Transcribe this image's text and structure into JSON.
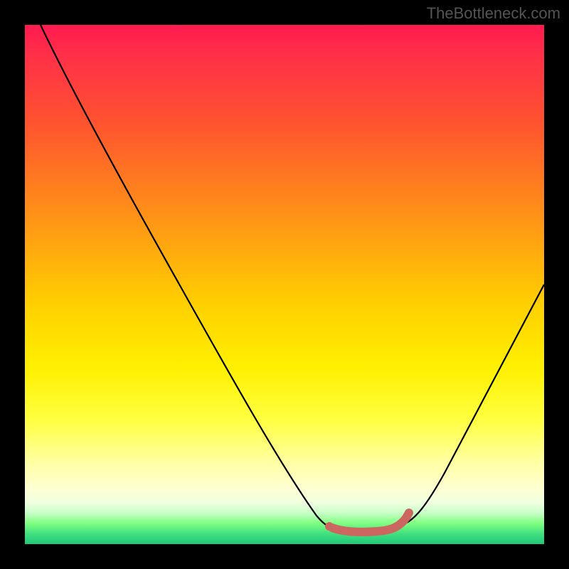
{
  "watermark": "TheBottleneck.com",
  "chart_data": {
    "type": "line",
    "title": "",
    "xlabel": "",
    "ylabel": "",
    "xlim": [
      0,
      100
    ],
    "ylim": [
      0,
      100
    ],
    "series": [
      {
        "name": "bottleneck-curve",
        "x": [
          3,
          10,
          20,
          30,
          40,
          50,
          55,
          58,
          60,
          63,
          67,
          70,
          73,
          78,
          85,
          92,
          100
        ],
        "y": [
          100,
          86,
          68,
          52,
          37,
          22,
          12,
          6,
          3,
          2,
          2,
          2,
          3,
          8,
          20,
          34,
          50
        ]
      },
      {
        "name": "optimal-range-marker",
        "x": [
          59,
          62,
          66,
          70,
          72,
          73
        ],
        "y": [
          3.2,
          2.3,
          2.2,
          2.5,
          3.3,
          4.8
        ]
      }
    ],
    "gradient_stops": [
      {
        "pos": 0,
        "color": "#ff1a50"
      },
      {
        "pos": 50,
        "color": "#ffd000"
      },
      {
        "pos": 80,
        "color": "#ffff60"
      },
      {
        "pos": 100,
        "color": "#20c878"
      }
    ]
  }
}
